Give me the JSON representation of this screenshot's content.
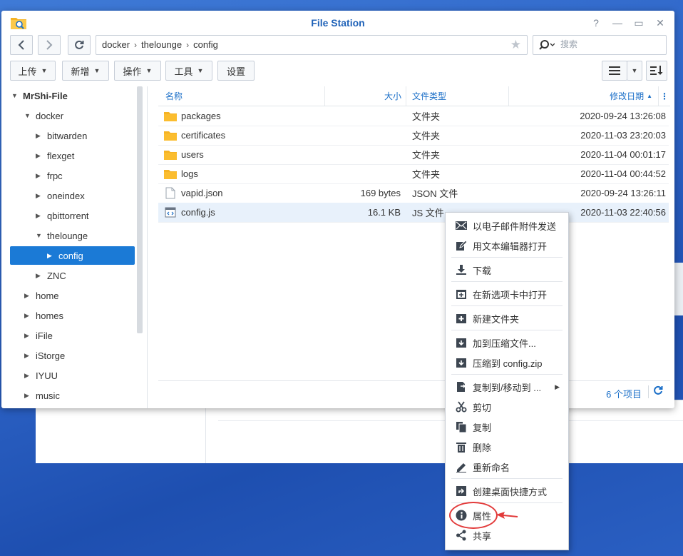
{
  "window": {
    "title": "File Station",
    "buttons": [
      "?",
      "—",
      "▭",
      "✕"
    ]
  },
  "nav": {
    "path": [
      "docker",
      "thelounge",
      "config"
    ],
    "search_placeholder": "搜索"
  },
  "toolbar": {
    "upload": "上传",
    "create": "新增",
    "action": "操作",
    "tools": "工具",
    "settings": "设置"
  },
  "sidebar": {
    "root": "MrShi-File",
    "docker": "docker",
    "docker_children": [
      "bitwarden",
      "flexget",
      "frpc",
      "oneindex",
      "qbittorrent"
    ],
    "thelounge": "thelounge",
    "config": "config",
    "znc": "ZNC",
    "others": [
      "home",
      "homes",
      "iFile",
      "iStorge",
      "IYUU",
      "music"
    ]
  },
  "columns": {
    "name": "名称",
    "size": "大小",
    "type": "文件类型",
    "modified": "修改日期",
    "sort_indicator": "▲"
  },
  "files": [
    {
      "name": "packages",
      "size": "",
      "type": "文件夹",
      "date": "2020-09-24 13:26:08",
      "icon": "folder-icon"
    },
    {
      "name": "certificates",
      "size": "",
      "type": "文件夹",
      "date": "2020-11-03 23:20:03",
      "icon": "folder-icon"
    },
    {
      "name": "users",
      "size": "",
      "type": "文件夹",
      "date": "2020-11-04 00:01:17",
      "icon": "folder-icon"
    },
    {
      "name": "logs",
      "size": "",
      "type": "文件夹",
      "date": "2020-11-04 00:44:52",
      "icon": "folder-icon"
    },
    {
      "name": "vapid.json",
      "size": "169 bytes",
      "type": "JSON 文件",
      "date": "2020-09-24 13:26:11",
      "icon": "file-icon"
    },
    {
      "name": "config.js",
      "size": "16.1 KB",
      "type": "JS 文件",
      "date": "2020-11-03 22:40:56",
      "icon": "code-file-icon"
    }
  ],
  "footer": {
    "count": "6 个项目"
  },
  "context_menu": {
    "email": "以电子邮件附件发送",
    "open_editor": "用文本编辑器打开",
    "download": "下载",
    "open_new_tab": "在新选项卡中打开",
    "new_folder": "新建文件夹",
    "add_archive": "加到压缩文件...",
    "compress_to": "压缩到 config.zip",
    "copy_move": "复制到/移动到 ...",
    "cut": "剪切",
    "copy": "复制",
    "delete": "删除",
    "rename": "重新命名",
    "shortcut": "创建桌面快捷方式",
    "properties": "属性",
    "share": "共享"
  },
  "colors": {
    "accent": "#1b7ad6",
    "folder": "#f5b324",
    "annotation": "#e23a3a"
  }
}
